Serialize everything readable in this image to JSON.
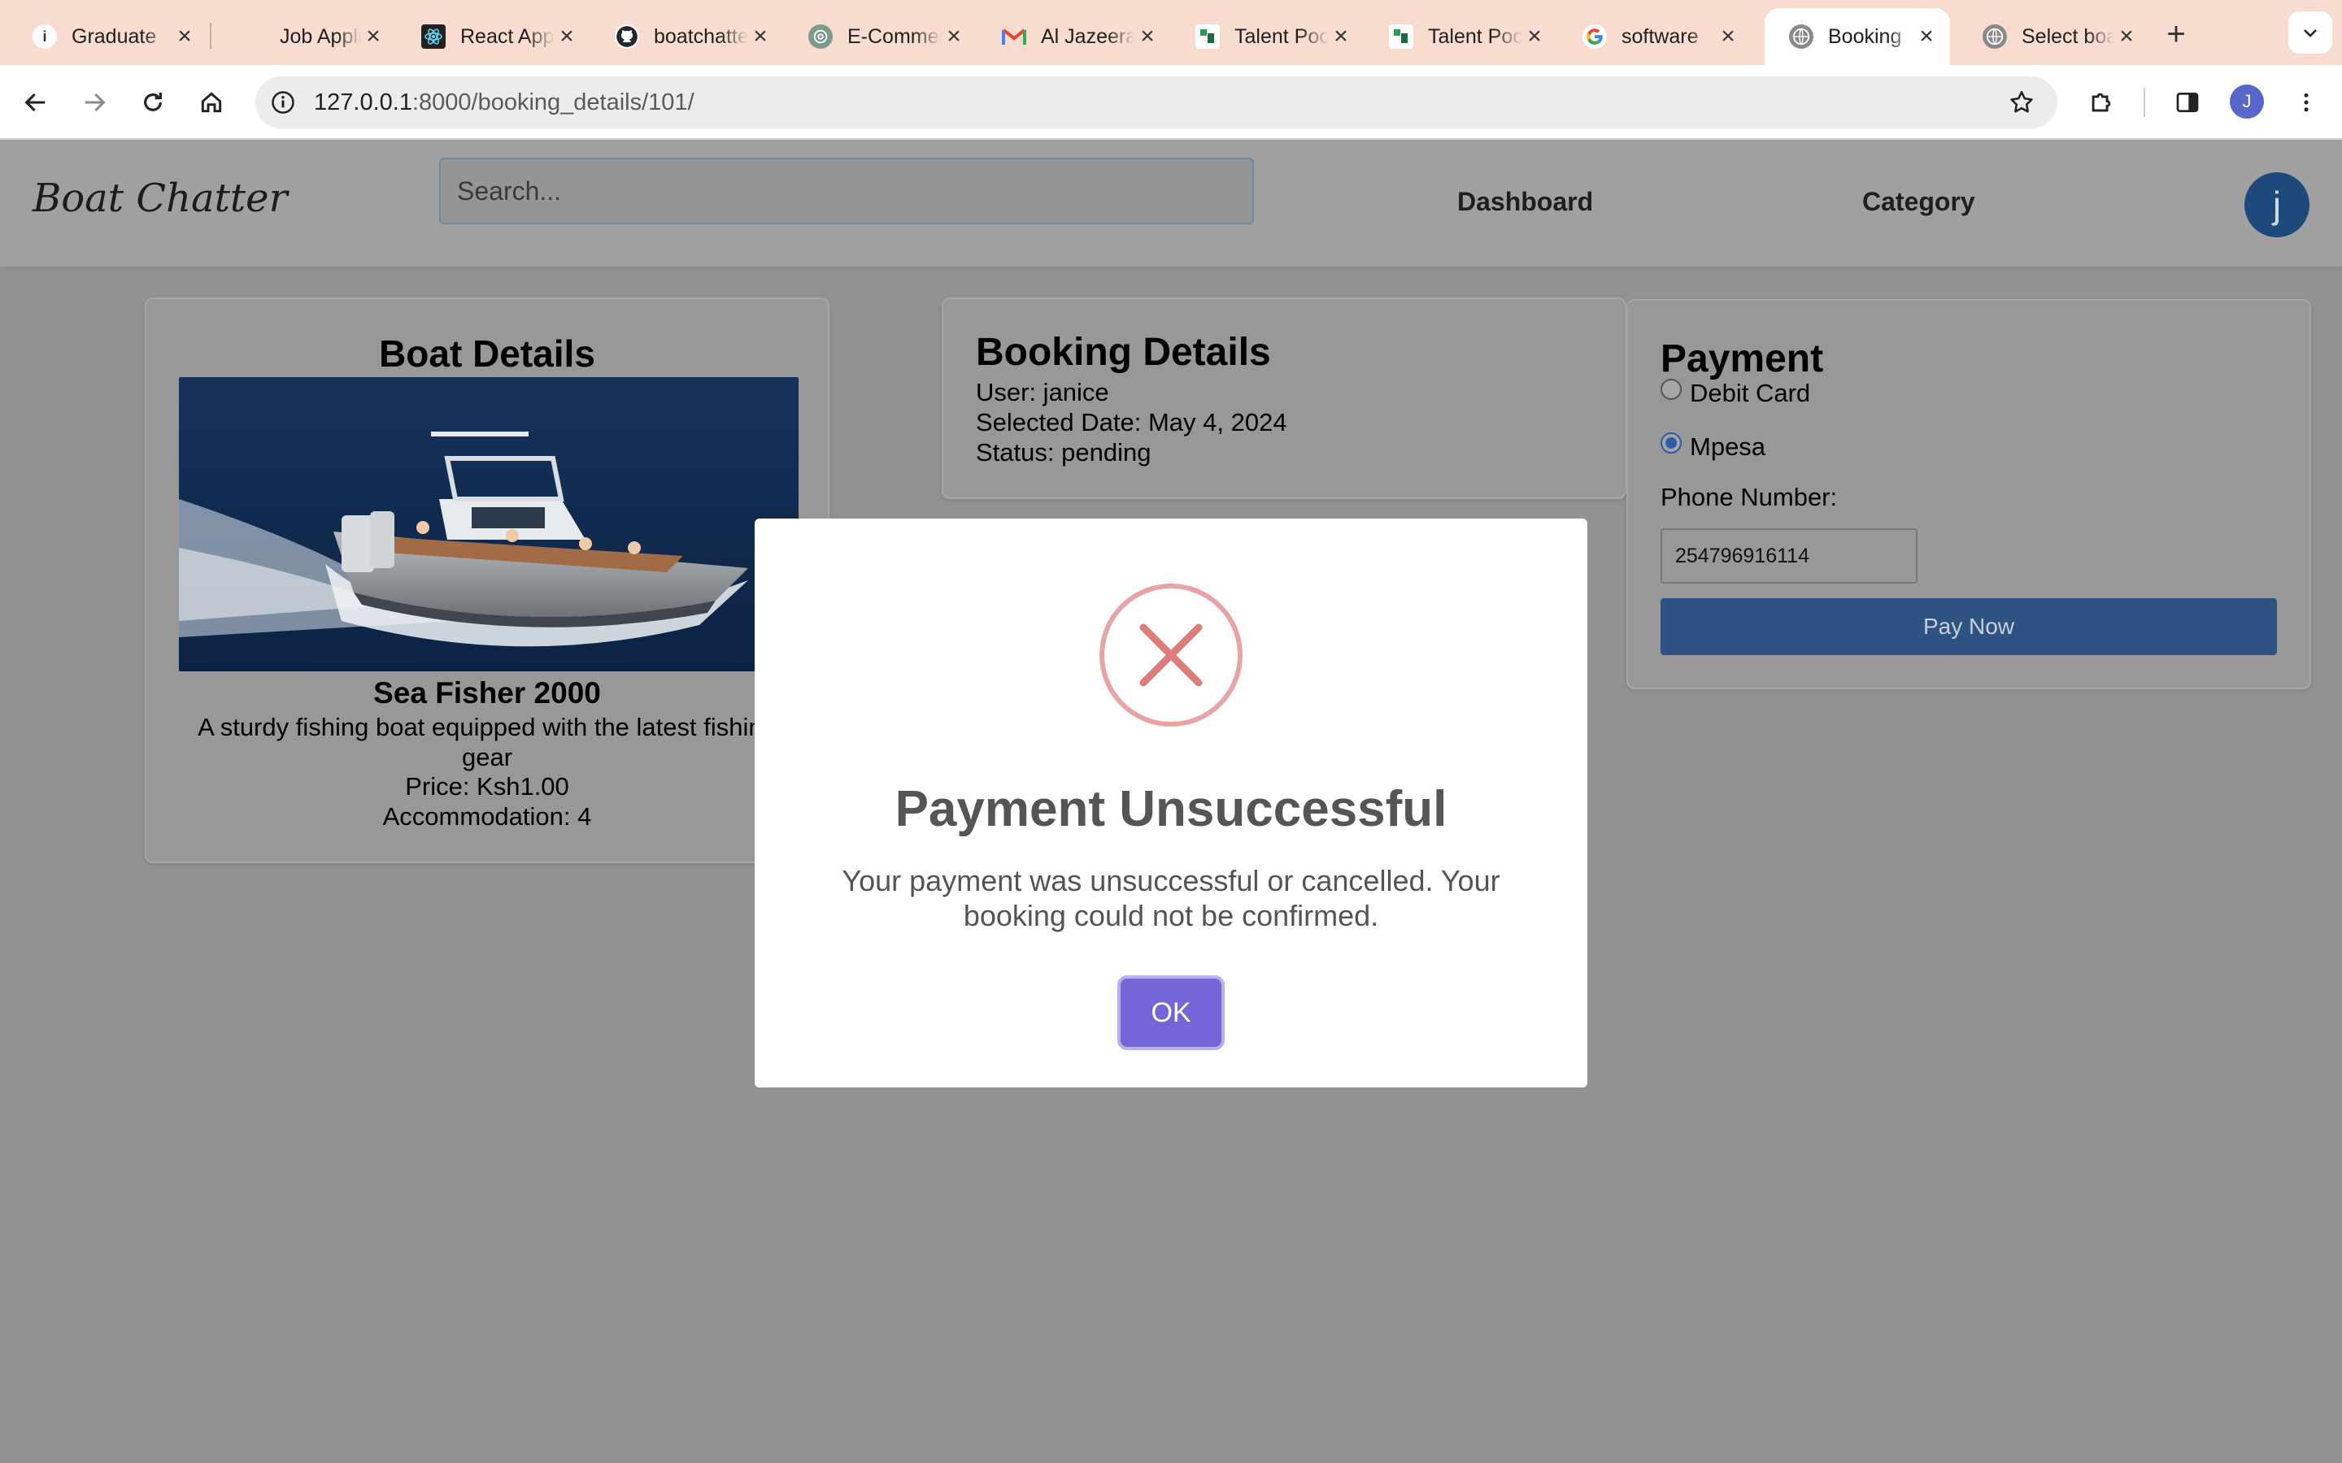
{
  "browser": {
    "tabs": [
      {
        "title": "Graduate",
        "favicon": "info-icon",
        "color": "#4a4a4a"
      },
      {
        "title": "Job Applic",
        "favicon": "blank-icon",
        "color": "#f7dccf"
      },
      {
        "title": "React App",
        "favicon": "react-icon",
        "color": "#222222"
      },
      {
        "title": "boatchatter",
        "favicon": "github-icon",
        "color": "#ffffff"
      },
      {
        "title": "E-Commerce",
        "favicon": "chatgpt-icon",
        "color": "#7a9c8e"
      },
      {
        "title": "Al Jazeera",
        "favicon": "gmail-icon",
        "color": "#ffffff"
      },
      {
        "title": "Talent Pool",
        "favicon": "talent-icon",
        "color": "#ffffff"
      },
      {
        "title": "Talent Pool",
        "favicon": "talent-icon",
        "color": "#ffffff"
      },
      {
        "title": "software",
        "favicon": "google-icon",
        "color": "#ffffff"
      },
      {
        "title": "Booking",
        "favicon": "globe-icon",
        "color": "#8a8a8a",
        "active": true
      },
      {
        "title": "Select boat",
        "favicon": "globe-icon",
        "color": "#8a8a8a"
      }
    ],
    "url_host": "127.0.0.1",
    "url_path": ":8000/booking_details/101/",
    "profile_initial": "J"
  },
  "site": {
    "logo": "Boat Chatter",
    "search_placeholder": "Search...",
    "nav": {
      "dashboard": "Dashboard",
      "category": "Category"
    },
    "avatar_initial": "j"
  },
  "boat": {
    "heading": "Boat Details",
    "name": "Sea Fisher 2000",
    "description": "A sturdy fishing boat equipped with the latest fishing gear",
    "price": "Price: Ksh1.00",
    "accommodation": "Accommodation: 4"
  },
  "booking": {
    "heading": "Booking Details",
    "user": "User: janice",
    "date": "Selected Date: May 4, 2024",
    "status": "Status: pending"
  },
  "payment": {
    "heading": "Payment",
    "options": [
      {
        "label": "Debit Card",
        "checked": false
      },
      {
        "label": "Mpesa",
        "checked": true
      }
    ],
    "phone_label": "Phone Number:",
    "phone_value": "254796916114",
    "pay_button": "Pay Now"
  },
  "modal": {
    "title": "Payment Unsuccessful",
    "message": "Your payment was unsuccessful or cancelled. Your booking could not be confirmed.",
    "ok_label": "OK",
    "icon_color": "#e07b7b",
    "button_color": "#7367d8"
  }
}
